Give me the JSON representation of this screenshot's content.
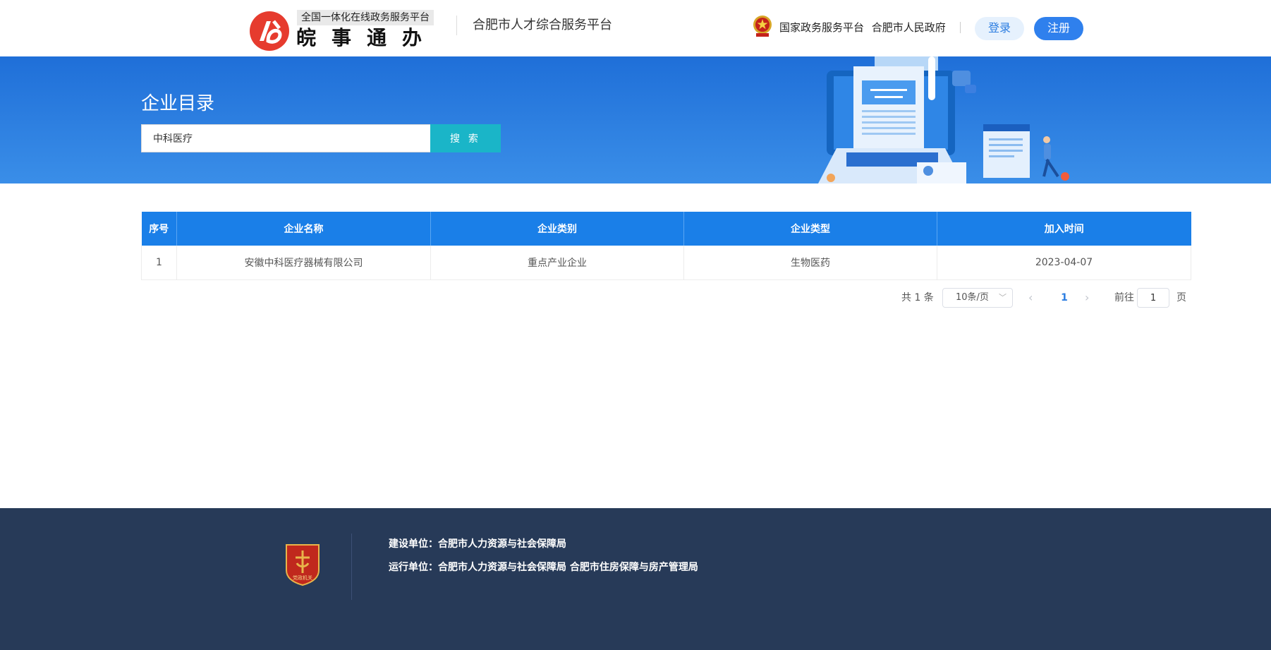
{
  "header": {
    "logo_sub": "全国一体化在线政务服务平台",
    "logo_main": "皖事通办",
    "platform_title": "合肥市人才综合服务平台",
    "gov_link_1": "国家政务服务平台",
    "gov_link_2": "合肥市人民政府",
    "login_label": "登录",
    "register_label": "注册"
  },
  "banner": {
    "title": "企业目录",
    "search_value": "中科医疗",
    "search_button": "搜 索"
  },
  "table": {
    "headers": [
      "序号",
      "企业名称",
      "企业类别",
      "企业类型",
      "加入时间"
    ],
    "rows": [
      [
        "1",
        "安徽中科医疗器械有限公司",
        "重点产业企业",
        "生物医药",
        "2023-04-07"
      ]
    ]
  },
  "pagination": {
    "total": "共 1 条",
    "page_size": "10条/页",
    "current_page": "1",
    "goto_label": "前往",
    "goto_value": "1",
    "page_suffix": "页"
  },
  "footer": {
    "badge_text": "党政机关",
    "build_unit": "建设单位：合肥市人力资源与社会保障局",
    "run_unit": "运行单位：合肥市人力资源与社会保障局 合肥市住房保障与房产管理局"
  },
  "colors": {
    "primary_blue": "#1a7fe8",
    "search_button": "#1ab5c8",
    "footer_bg": "#273a58",
    "register_button": "#2f80ed"
  }
}
